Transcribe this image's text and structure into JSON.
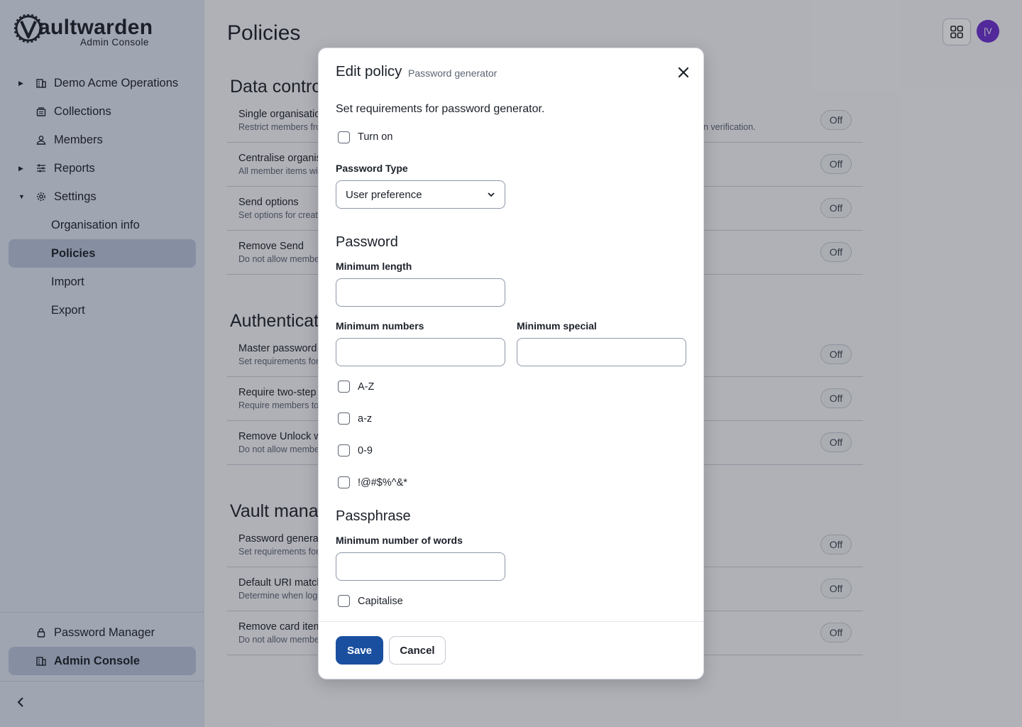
{
  "brand": {
    "name_bold": "aultwarden",
    "subtitle": "Admin Console"
  },
  "sidebar": {
    "items": [
      {
        "label": "Demo Acme Operations",
        "icon": "building-icon"
      },
      {
        "label": "Collections",
        "icon": "collection-icon"
      },
      {
        "label": "Members",
        "icon": "user-icon"
      },
      {
        "label": "Reports",
        "icon": "sliders-icon"
      },
      {
        "label": "Settings",
        "icon": "gear-icon"
      },
      {
        "label": "Organisation info"
      },
      {
        "label": "Policies"
      },
      {
        "label": "Import"
      },
      {
        "label": "Export"
      }
    ],
    "bottom": [
      {
        "label": "Password Manager",
        "icon": "lock-icon"
      },
      {
        "label": "Admin Console",
        "icon": "building-icon"
      }
    ]
  },
  "header": {
    "title": "Policies",
    "avatar_initials": "[V"
  },
  "sections": [
    {
      "title": "Data controls",
      "policies": [
        {
          "name": "Single organisation",
          "desc": "Restrict members from joining other organisations.",
          "extra": "n verification.",
          "status": "Off"
        },
        {
          "name": "Centralise organisation ownership",
          "desc": "All member items will be owned and managed by the organisation.",
          "status": "Off"
        },
        {
          "name": "Send options",
          "desc": "Set options for creating and editing Sends.",
          "status": "Off"
        },
        {
          "name": "Remove Send",
          "desc": "Do not allow members to create or edit a Send.",
          "status": "Off"
        }
      ]
    },
    {
      "title": "Authentication",
      "policies": [
        {
          "name": "Master password requirements",
          "desc": "Set requirements for master password strength.",
          "status": "Off"
        },
        {
          "name": "Require two-step login",
          "desc": "Require members to set up two-step login.",
          "status": "Off"
        },
        {
          "name": "Remove Unlock with PIN",
          "desc": "Do not allow members to unlock their account with a PIN.",
          "status": "Off"
        }
      ]
    },
    {
      "title": "Vault management",
      "policies": [
        {
          "name": "Password generator",
          "desc": "Set requirements for password generator.",
          "status": "Off"
        },
        {
          "name": "Default URI match detection",
          "desc": "Determine when logins are suggested for autofill.",
          "status": "Off"
        },
        {
          "name": "Remove card item type",
          "desc": "Do not allow members to create card item types.",
          "status": "Off"
        }
      ]
    }
  ],
  "modal": {
    "title": "Edit policy",
    "subtitle": "Password generator",
    "description": "Set requirements for password generator.",
    "turn_on_label": "Turn on",
    "password_type_label": "Password Type",
    "password_type_value": "User preference",
    "password_heading": "Password",
    "min_length_label": "Minimum length",
    "min_numbers_label": "Minimum numbers",
    "min_special_label": "Minimum special",
    "options": [
      "A-Z",
      "a-z",
      "0-9",
      "!@#$%^&*"
    ],
    "passphrase_heading": "Passphrase",
    "min_words_label": "Minimum number of words",
    "capitalise_label": "Capitalise",
    "save_label": "Save",
    "cancel_label": "Cancel"
  },
  "colors": {
    "accent": "#1a4fa0",
    "avatar": "#6b2fd1"
  }
}
